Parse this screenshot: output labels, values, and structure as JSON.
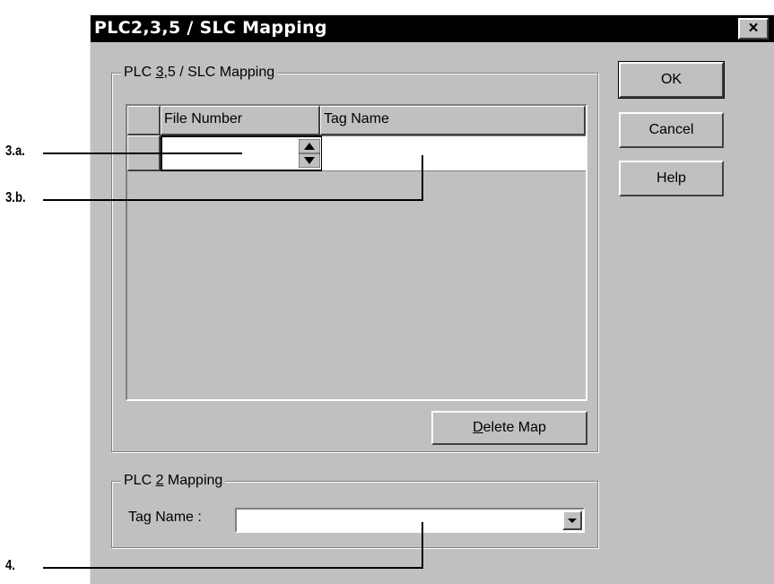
{
  "window": {
    "title": "PLC2,3,5 / SLC Mapping",
    "close_glyph": "×"
  },
  "group_plc35": {
    "label_pre": "PLC ",
    "label_mnemonic": "3",
    "label_post": ",5 / SLC Mapping"
  },
  "table": {
    "columns": [
      "File Number",
      "Tag Name"
    ],
    "rows": [
      {
        "file_number": "",
        "tag_name": ""
      }
    ]
  },
  "delete_button": {
    "mnemonic": "D",
    "rest": "elete Map"
  },
  "group_plc2": {
    "label_pre": "PLC ",
    "label_mnemonic": "2",
    "label_post": " Mapping",
    "tag_label": "Tag Name :",
    "tag_value": ""
  },
  "buttons": {
    "ok": "OK",
    "cancel": "Cancel",
    "help": "Help"
  },
  "callouts": {
    "a": "3.a.",
    "b": "3.b.",
    "c": "4."
  },
  "icons": {
    "spin": "spin-updown-icon",
    "dropdown": "dropdown-arrow-icon",
    "close": "close-icon"
  }
}
